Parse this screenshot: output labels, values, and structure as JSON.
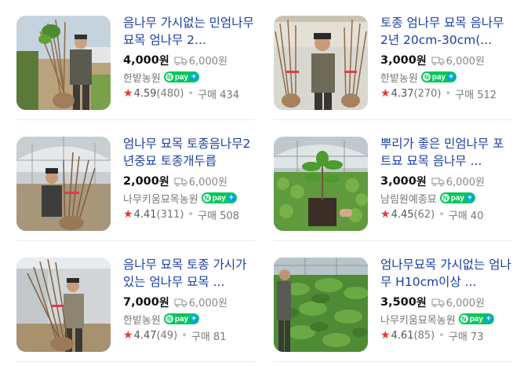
{
  "products": [
    {
      "title": "음나무 가시없는 민엄나무 묘목 엄나무 2...",
      "price": "4,000",
      "won": "원",
      "shipping": "6,000원",
      "seller": "한밭농원",
      "rating": "4.59",
      "reviews": "(480)",
      "purchase": "구매 434",
      "photo": "man-holding-saplings"
    },
    {
      "title": "토종 엄나무 묘목 음나무 2년 20cm-30cm(...",
      "price": "3,000",
      "won": "원",
      "shipping": "6,000원",
      "seller": "한밭농원",
      "rating": "4.37",
      "reviews": "(270)",
      "purchase": "구매 512",
      "photo": "man-holding-two-bundles"
    },
    {
      "title": "엄나무 묘목 토종음나무2년중묘 토종개두릅",
      "price": "2,000",
      "won": "원",
      "shipping": "6,000원",
      "seller": "나무키움묘목농원",
      "rating": "4.41",
      "reviews": "(311)",
      "purchase": "구매 508",
      "photo": "greenhouse-seedling-bundle"
    },
    {
      "title": "뿌리가 좋은 민엄나무 포트묘 묘목 음나무 ...",
      "price": "3,000",
      "won": "원",
      "shipping": "6,000원",
      "seller": "남림원예종묘",
      "rating": "4.45",
      "reviews": "(62)",
      "purchase": "구매 40",
      "photo": "potted-seedling-greenhouse"
    },
    {
      "title": "음나무 묘목 토종 가시가있는 엄나무 묘목 ...",
      "price": "7,000",
      "won": "원",
      "shipping": "6,000원",
      "seller": "한밭농원",
      "rating": "4.47",
      "reviews": "(49)",
      "purchase": "구매 81",
      "photo": "man-holding-long-saplings"
    },
    {
      "title": "엄나무묘목 가시없는 엄나무 H10cm이상 ...",
      "price": "3,500",
      "won": "원",
      "shipping": "6,000원",
      "seller": "나무키움묘목농원",
      "rating": "4.61",
      "reviews": "(85)",
      "purchase": "구매 73",
      "photo": "greenhouse-leafy-seedlings"
    }
  ],
  "npay": {
    "n": "N",
    "label": "pay",
    "plus": "+"
  },
  "star_icon": "★",
  "dot": "•",
  "colors": {
    "title": "#1a3ea8",
    "npay": "#03c75a",
    "npay_plus": "#00a0e9",
    "star": "#e8362f",
    "text_gray": "#777777"
  }
}
